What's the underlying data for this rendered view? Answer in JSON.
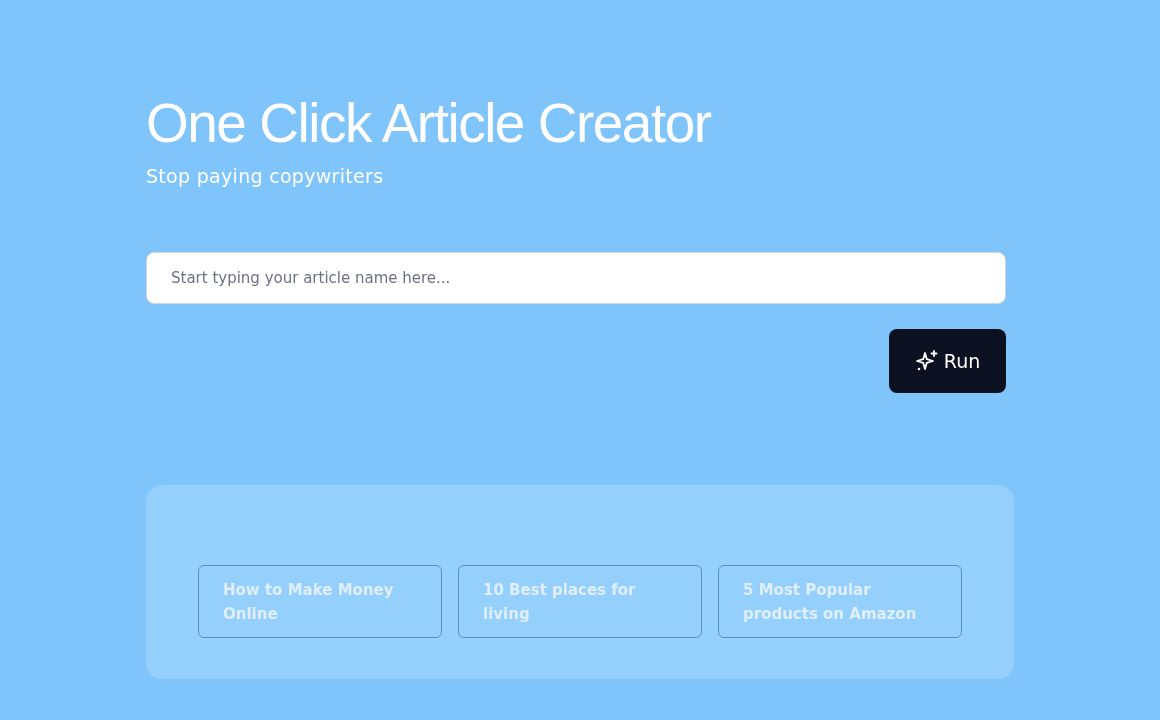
{
  "header": {
    "title": "One Click Article Creator",
    "subtitle": "Stop paying copywriters"
  },
  "search": {
    "placeholder": "Start typing your article name here..."
  },
  "run_button": {
    "label": "Run"
  },
  "suggestions": [
    {
      "label": "How to Make Money Online"
    },
    {
      "label": "10 Best places for living"
    },
    {
      "label": "5 Most Popular products on Amazon"
    }
  ]
}
